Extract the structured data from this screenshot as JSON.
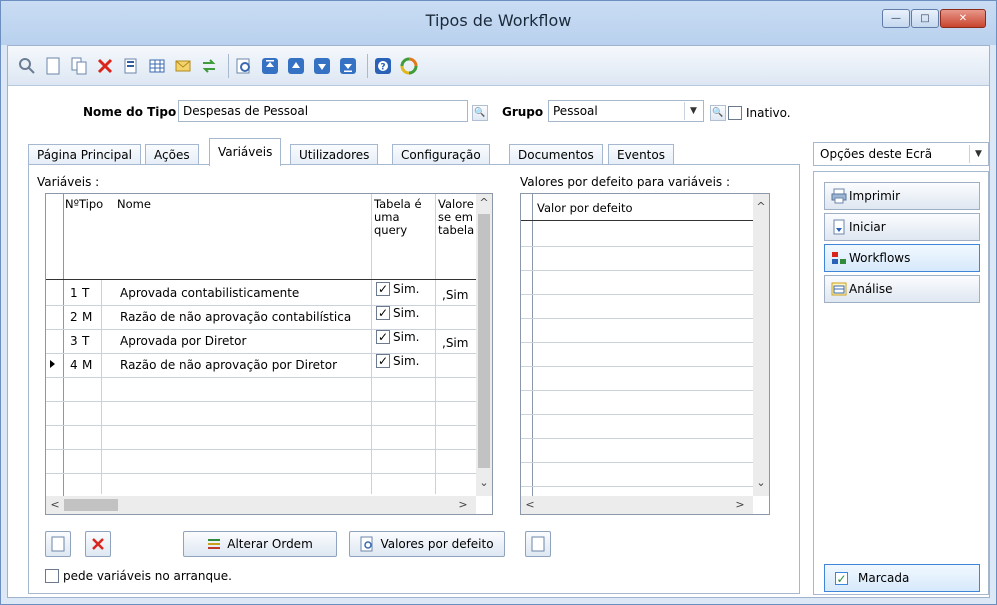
{
  "window": {
    "title": "Tipos de Workflow"
  },
  "header": {
    "nome_label": "Nome do Tipo",
    "nome_value": "Despesas de Pessoal",
    "grupo_label": "Grupo",
    "grupo_value": "Pessoal",
    "inativo_label": "Inativo."
  },
  "tabs": [
    {
      "label": "Página Principal"
    },
    {
      "label": "Ações"
    },
    {
      "label": "Variáveis"
    },
    {
      "label": "Utilizadores"
    },
    {
      "label": "Configuração"
    },
    {
      "label": "Documentos"
    },
    {
      "label": "Eventos"
    }
  ],
  "variaveis": {
    "section_label": "Variáveis :",
    "columns": {
      "num": "Nº",
      "tipo": "Tipo",
      "nome": "Nome",
      "tabela": "Tabela é uma query",
      "valores": "Valores se em tabela"
    },
    "rows": [
      {
        "num": "1",
        "tipo": "T",
        "nome": "Aprovada contabilisticamente",
        "tabela": "Sim.",
        "valor": ",Sim"
      },
      {
        "num": "2",
        "tipo": "M",
        "nome": "Razão de não aprovação contabilística",
        "tabela": "Sim.",
        "valor": ""
      },
      {
        "num": "3",
        "tipo": "T",
        "nome": "Aprovada por Diretor",
        "tabela": "Sim.",
        "valor": ",Sim"
      },
      {
        "num": "4",
        "tipo": "M",
        "nome": "Razão de não aprovação por Diretor",
        "tabela": "Sim.",
        "valor": ""
      }
    ]
  },
  "defaults": {
    "section_label": "Valores por defeito para variáveis :",
    "column": "Valor por defeito"
  },
  "buttons": {
    "alterar_ordem": "Alterar Ordem",
    "valores_defeito": "Valores por defeito",
    "pede_variaveis": "pede variáveis no arranque."
  },
  "options": {
    "dropdown": "Opções deste Ecrã",
    "items": [
      {
        "label": "Imprimir"
      },
      {
        "label": "Iniciar"
      },
      {
        "label": "Workflows"
      },
      {
        "label": "Análise"
      }
    ],
    "marcada": "Marcada"
  },
  "colors": {
    "accent": "#3f86d8",
    "delete_red": "#d9261c"
  }
}
